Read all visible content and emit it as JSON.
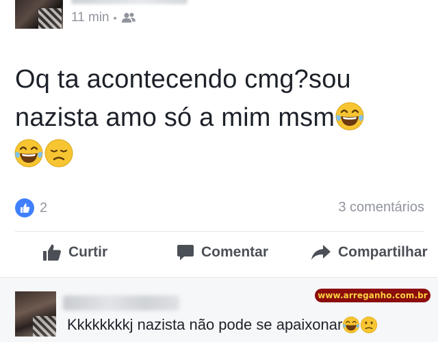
{
  "post": {
    "meta": {
      "time": "11 min",
      "separator": "•",
      "audience_icon": "friends-icon"
    },
    "text_line1": "Oq ta acontecendo cmg?sou",
    "text_line2": "nazista  amo só a mim msm",
    "emojis": [
      "laughing-tears-emoji",
      "laughing-tears-emoji",
      "disappointed-emoji"
    ],
    "reaction_count": "2",
    "comments_count": "3 comentários"
  },
  "actions": {
    "like_label": "Curtir",
    "comment_label": "Comentar",
    "share_label": "Compartilhar"
  },
  "comment": {
    "text": "Kkkkkkkkj nazista não pode se apaixonar",
    "emojis": [
      "laughing-tears-emoji",
      "slight-frown-emoji"
    ]
  },
  "watermark": "www.arreganho.com.br",
  "colors": {
    "like_blue": "#4080ff",
    "meta_gray": "#90949c",
    "action_gray": "#4b4f56",
    "emoji_yellow": "#f7c531",
    "watermark_bg": "#8b0d0d",
    "watermark_text": "#ffd23f"
  }
}
